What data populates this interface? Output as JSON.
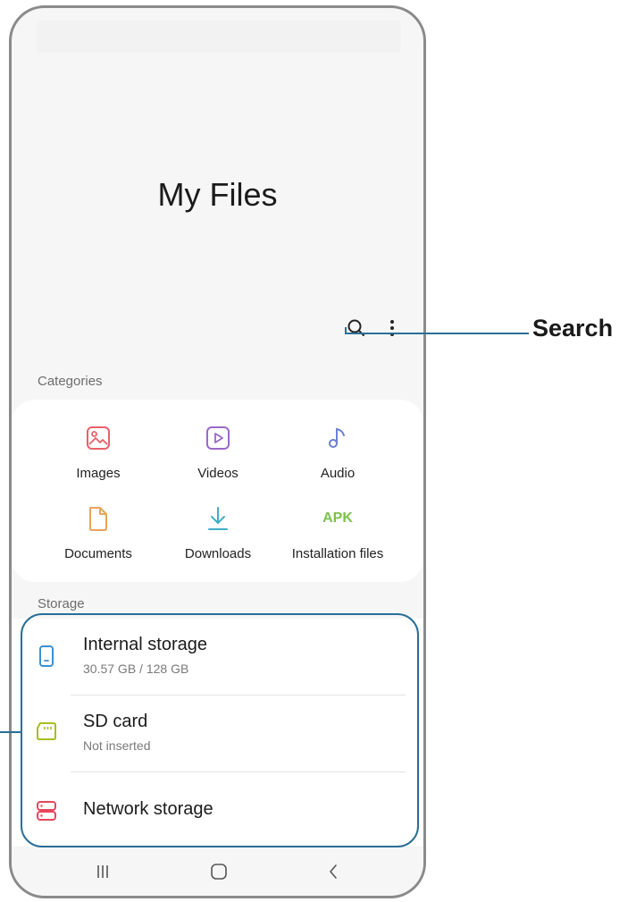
{
  "app": {
    "title": "My Files"
  },
  "toolbar": {
    "search_icon": "search-icon",
    "more_icon": "more-options-icon"
  },
  "categories": {
    "title": "Categories",
    "items": [
      {
        "label": "Images",
        "icon": "images-icon",
        "color": "#e8616a"
      },
      {
        "label": "Videos",
        "icon": "videos-icon",
        "color": "#9b68c9"
      },
      {
        "label": "Audio",
        "icon": "audio-icon",
        "color": "#6b7fd4"
      },
      {
        "label": "Documents",
        "icon": "documents-icon",
        "color": "#e8a45c"
      },
      {
        "label": "Downloads",
        "icon": "downloads-icon",
        "color": "#3fb0c8"
      },
      {
        "label": "Installation files",
        "icon": "apk-icon",
        "icon_text": "APK",
        "color": "#7cc24a"
      }
    ]
  },
  "storage": {
    "title": "Storage",
    "items": [
      {
        "name": "Internal storage",
        "detail": "30.57 GB / 128 GB",
        "icon": "phone-storage-icon",
        "color": "#3c8fd0"
      },
      {
        "name": "SD card",
        "detail": "Not inserted",
        "icon": "sd-card-icon",
        "color": "#a7be1e"
      },
      {
        "name": "Network storage",
        "icon": "network-storage-icon",
        "color": "#e8455c"
      }
    ]
  },
  "callout": {
    "label": "Search",
    "color": "#2a6f97"
  }
}
